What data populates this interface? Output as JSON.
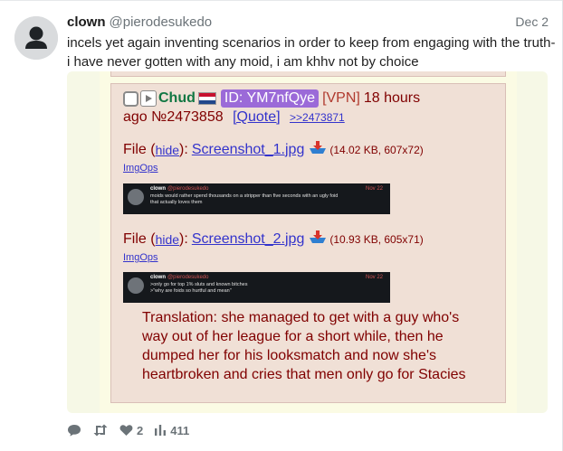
{
  "post": {
    "display_name": "clown",
    "handle": "@pierodesukedo",
    "date": "Dec 2",
    "text": "incels yet again inventing scenarios in order to keep from engaging with the truth- i have never gotten with any moid, i am khhv not by choice"
  },
  "embedded": {
    "poster_name": "Chud",
    "id_label": "ID: YM7nfQye",
    "vpn": "[VPN]",
    "time_part1": "18 hours",
    "time_part2": "ago",
    "post_number": "№2473858",
    "quote_label": "[Quote]",
    "backlink": ">>2473871",
    "files": [
      {
        "label": "File",
        "hide_prefix": "(",
        "hide": "hide",
        "hide_suffix": "):",
        "filename": "Screenshot_1.jpg",
        "meta": "(14.02 KB, 607x72)",
        "imgops": "ImgOps",
        "thumb": {
          "name": "clown",
          "handle": "@pierodesukedo",
          "date": "Nov 22",
          "lines": [
            "moids would rather spend thousands on a stripper than five seconds with an ugly foid",
            "that actually loves them"
          ]
        }
      },
      {
        "label": "File",
        "hide_prefix": "(",
        "hide": "hide",
        "hide_suffix": "):",
        "filename": "Screenshot_2.jpg",
        "meta": "(10.93 KB, 605x71)",
        "imgops": "ImgOps",
        "thumb": {
          "name": "clown",
          "handle": "@pierodesukedo",
          "date": "Nov 22",
          "lines": [
            ">only go for top 1% sluts and known bitches",
            ">\"why are foids so hurtful and mean\""
          ]
        }
      }
    ],
    "translation": "Translation: she managed to get with a guy who's way out of her league for a short while, then he dumped her for his looksmatch and now she's heartbroken and cries that men only go for Stacies"
  },
  "actions": {
    "reply_icon": "reply-icon",
    "repost_icon": "repost-icon",
    "like_icon": "heart-icon",
    "like_count": "2",
    "stats_icon": "bar-chart-icon",
    "views_count": "411"
  },
  "colors": {
    "greentext_name": "#117743",
    "post_bg": "#f0e0d6",
    "maroon": "#800000",
    "link_blue": "#3333cc",
    "id_purple": "#9b6ad8"
  }
}
